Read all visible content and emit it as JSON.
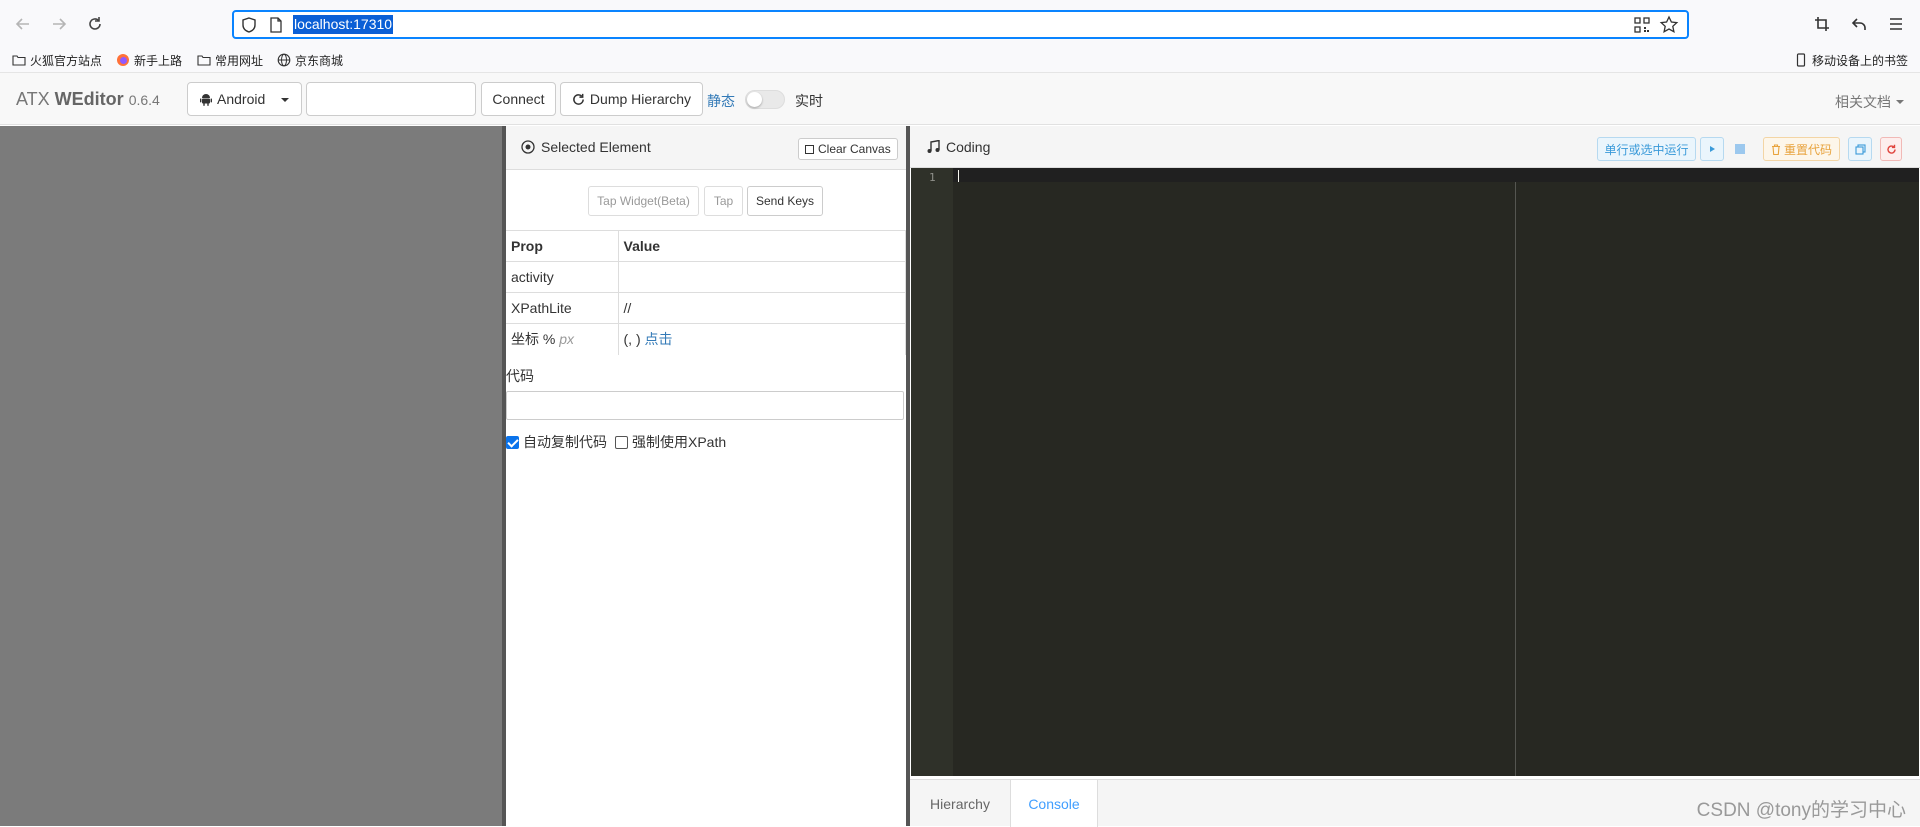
{
  "browser": {
    "url": "localhost:17310",
    "bookmarks": [
      {
        "label": "火狐官方站点",
        "icon": "folder-icon"
      },
      {
        "label": "新手上路",
        "icon": "firefox-icon"
      },
      {
        "label": "常用网址",
        "icon": "folder-icon"
      },
      {
        "label": "京东商城",
        "icon": "globe-icon"
      }
    ],
    "mobile_bookmarks": "移动设备上的书签"
  },
  "header": {
    "brand_prefix": "ATX ",
    "brand_name": "WEditor",
    "version": "0.6.4",
    "platform": "Android",
    "serial_value": "",
    "connect_label": "Connect",
    "dump_label": "Dump Hierarchy",
    "static_label": "静态",
    "realtime_label": "实时",
    "realtime_on": false,
    "docs_label": "相关文档"
  },
  "element_panel": {
    "title": "Selected Element",
    "clear_label": "Clear Canvas",
    "actions": {
      "tap_widget": "Tap Widget(Beta)",
      "tap": "Tap",
      "send_keys": "Send Keys"
    },
    "table": {
      "headers": [
        "Prop",
        "Value"
      ],
      "rows": [
        {
          "prop": "activity",
          "value": ""
        },
        {
          "prop": "XPathLite",
          "value": "//"
        }
      ],
      "coord_prop": "坐标",
      "coord_percent": "%",
      "coord_px": "px",
      "coord_value": "(, )",
      "coord_link": "点击"
    },
    "code_label": "代码",
    "code_value": "",
    "auto_copy_label": "自动复制代码",
    "auto_copy_checked": true,
    "force_xpath_label": "强制使用XPath",
    "force_xpath_checked": false
  },
  "coding_panel": {
    "title": "Coding",
    "run_label": "单行或选中运行",
    "reset_label": "重置代码",
    "line_number": "1",
    "tabs": [
      "Hierarchy",
      "Console"
    ],
    "active_tab": "Console"
  },
  "watermark": "CSDN @tony的学习中心",
  "colors": {
    "accent": "#409eff",
    "link": "#337ab7",
    "editor_bg": "#272822",
    "screen_bg": "#7b7b7b",
    "url_selection": "#0a5fd6"
  }
}
